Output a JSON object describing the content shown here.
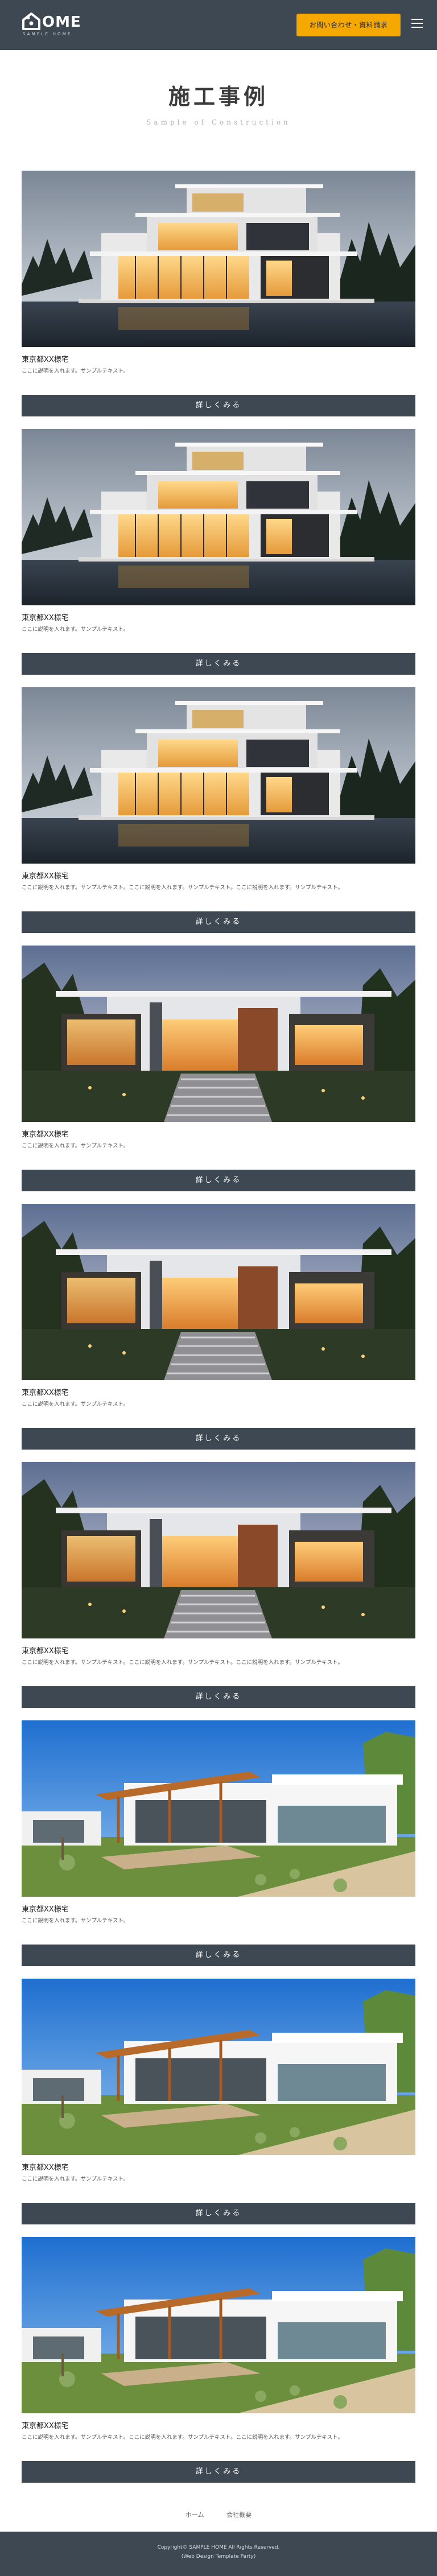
{
  "header": {
    "logo_text": "OME",
    "logo_sub": "SAMPLE HOME",
    "cta_label": "お問い合わせ・資料請求"
  },
  "page": {
    "title": "施工事例",
    "subtitle": "Sample of Construction"
  },
  "cards": [
    {
      "name": "東京都XX様宅",
      "desc": "ここに説明を入れます。サンプルテキスト。",
      "more": "詳しくみる",
      "image": "modern-house-dusk"
    },
    {
      "name": "東京都XX様宅",
      "desc": "ここに説明を入れます。サンプルテキスト。",
      "more": "詳しくみる",
      "image": "modern-house-dusk"
    },
    {
      "name": "東京都XX様宅",
      "desc": "ここに説明を入れます。サンプルテキスト。ここに説明を入れます。サンプルテキスト。ここに説明を入れます。サンプルテキスト。",
      "more": "詳しくみる",
      "image": "modern-house-dusk"
    },
    {
      "name": "東京都XX様宅",
      "desc": "ここに説明を入れます。サンプルテキスト。",
      "more": "詳しくみる",
      "image": "house-with-steps-evening"
    },
    {
      "name": "東京都XX様宅",
      "desc": "ここに説明を入れます。サンプルテキスト。",
      "more": "詳しくみる",
      "image": "house-with-steps-evening"
    },
    {
      "name": "東京都XX様宅",
      "desc": "ここに説明を入れます。サンプルテキスト。ここに説明を入れます。サンプルテキスト。ここに説明を入れます。サンプルテキスト。",
      "more": "詳しくみる",
      "image": "house-with-steps-evening"
    },
    {
      "name": "東京都XX様宅",
      "desc": "ここに説明を入れます。サンプルテキスト。",
      "more": "詳しくみる",
      "image": "white-house-wood-pergola"
    },
    {
      "name": "東京都XX様宅",
      "desc": "ここに説明を入れます。サンプルテキスト。",
      "more": "詳しくみる",
      "image": "white-house-wood-pergola"
    },
    {
      "name": "東京都XX様宅",
      "desc": "ここに説明を入れます。サンプルテキスト。ここに説明を入れます。サンプルテキスト。ここに説明を入れます。サンプルテキスト。",
      "more": "詳しくみる",
      "image": "white-house-wood-pergola"
    }
  ],
  "footer_nav": [
    {
      "label": "ホーム"
    },
    {
      "label": "会社概要"
    }
  ],
  "footer": {
    "copyright": "Copyright© SAMPLE HOME All Rights Reserved.",
    "template": "(Web Design Template Party)"
  },
  "colors": {
    "header_bg": "#3d4852",
    "accent": "#f5a800"
  }
}
